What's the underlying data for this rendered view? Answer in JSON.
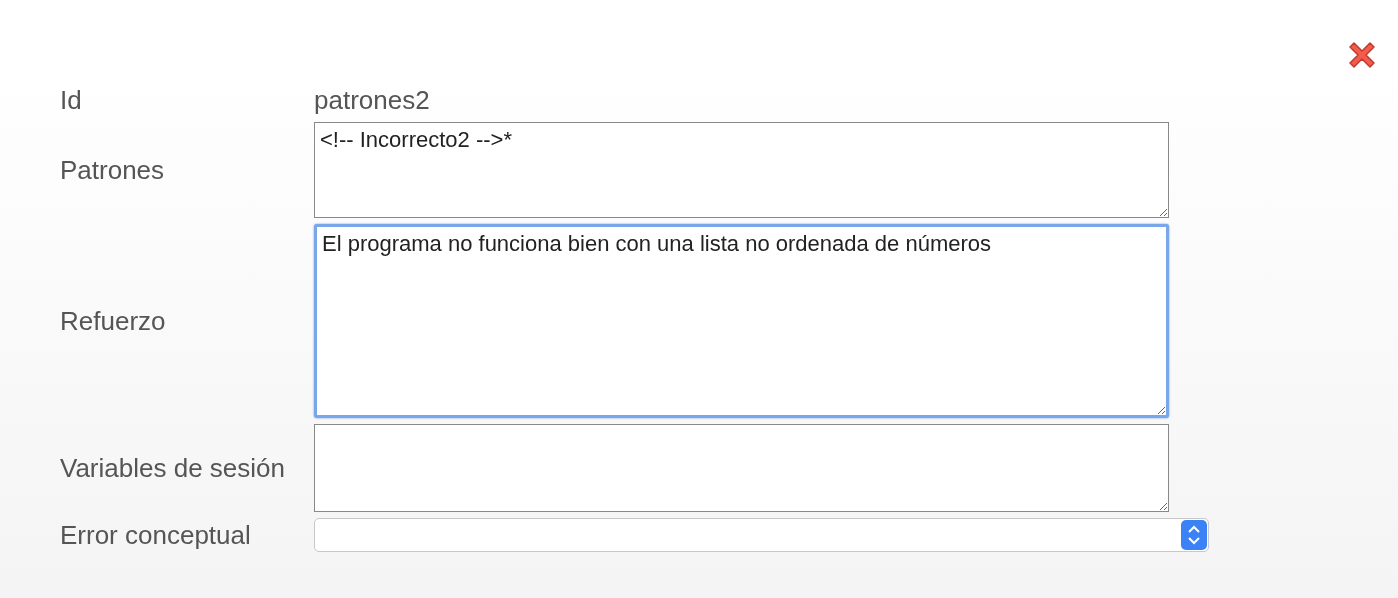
{
  "fields": [
    {
      "label": "Id",
      "kind": "text",
      "value": "patrones2"
    },
    {
      "label": "Patrones",
      "kind": "textarea",
      "value": "<!-- Incorrecto2 -->*",
      "focused": false
    },
    {
      "label": "Refuerzo",
      "kind": "textarea",
      "value": "El programa no funciona bien con una lista no ordenada de números",
      "focused": true
    },
    {
      "label": "Variables de sesión",
      "kind": "textarea",
      "focused": false
    },
    {
      "label": "Error conceptual",
      "kind": "select"
    }
  ]
}
